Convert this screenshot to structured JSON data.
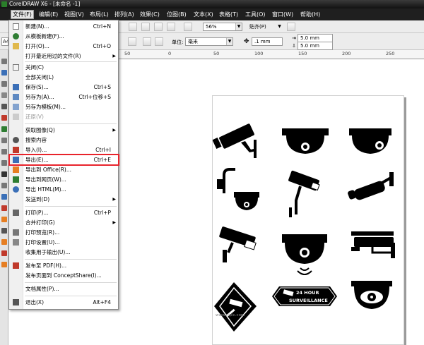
{
  "window": {
    "title": "CorelDRAW X6 - [未命名 -1]"
  },
  "menubar": [
    "文件(F)",
    "编辑(E)",
    "视图(V)",
    "布局(L)",
    "排列(A)",
    "效果(C)",
    "位图(B)",
    "文本(X)",
    "表格(T)",
    "工具(O)",
    "窗口(W)",
    "帮助(H)"
  ],
  "toolbar": {
    "zoom": "56%",
    "snap": "贴齐(P)"
  },
  "propbar": {
    "paper_size": "A4",
    "units_label": "单位:",
    "units": "毫米",
    "nudge": ".1 mm",
    "dup_x": "5.0 mm",
    "dup_y": "5.0 mm"
  },
  "ruler": {
    "labels": [
      "50",
      "0",
      "50",
      "100",
      "150",
      "200",
      "250"
    ]
  },
  "file_menu": {
    "items": [
      {
        "label": "新建(N)...",
        "shortcut": "Ctrl+N"
      },
      {
        "label": "从模板新建(F)..."
      },
      {
        "label": "打开(O)...",
        "shortcut": "Ctrl+O"
      },
      {
        "label": "打开最近用过的文件(R)",
        "submenu": "▶"
      },
      {
        "label": "关闭(C)"
      },
      {
        "label": "全部关闭(L)"
      },
      {
        "label": "保存(S)...",
        "shortcut": "Ctrl+S"
      },
      {
        "label": "另存为(A)...",
        "shortcut": "Ctrl+位移+S"
      },
      {
        "label": "另存为模板(M)..."
      },
      {
        "label": "还原(V)",
        "disabled": true
      },
      {
        "label": "获取图像(Q)",
        "submenu": "▶"
      },
      {
        "label": "搜索内容"
      },
      {
        "label": "导入(I)...",
        "shortcut": "Ctrl+I"
      },
      {
        "label": "导出(E)...",
        "shortcut": "Ctrl+E",
        "highlighted": true
      },
      {
        "label": "导出到 Office(R)..."
      },
      {
        "label": "导出到网页(W)..."
      },
      {
        "label": "导出 HTML(M)..."
      },
      {
        "label": "发送到(D)",
        "submenu": "▶"
      },
      {
        "label": "打印(P)...",
        "shortcut": "Ctrl+P"
      },
      {
        "label": "合并打印(G)",
        "submenu": "▶"
      },
      {
        "label": "打印预览(R)..."
      },
      {
        "label": "打印设置(U)..."
      },
      {
        "label": "收集用于输出(U)..."
      },
      {
        "label": "发布至 PDF(H)..."
      },
      {
        "label": "发布页面到 ConceptShare(I)..."
      },
      {
        "label": "文档属性(P)..."
      },
      {
        "label": "退出(X)",
        "shortcut": "Alt+F4"
      }
    ]
  },
  "artwork": {
    "badge_text": "24 HOUR SURVEILLANCE",
    "watermark": "www.nipic.com"
  },
  "colors": {
    "highlight_box": "#e8232b",
    "menubar_bg": "#1f1f1f"
  }
}
